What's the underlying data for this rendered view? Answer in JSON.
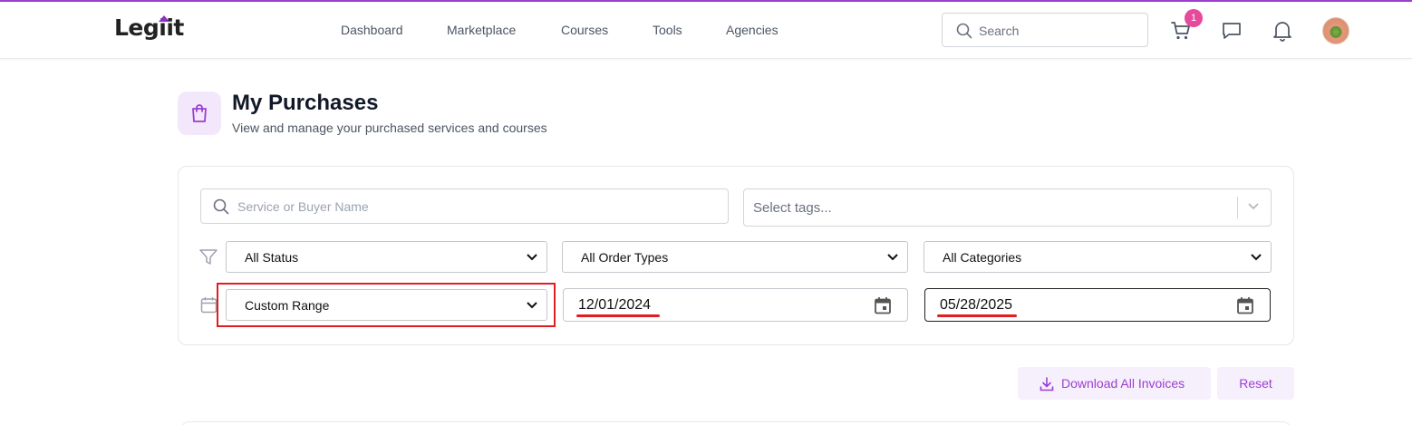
{
  "brand": {
    "name": "Legiit",
    "accent_color": "#9b3fd1"
  },
  "nav": {
    "links": [
      "Dashboard",
      "Marketplace",
      "Courses",
      "Tools",
      "Agencies"
    ]
  },
  "header": {
    "search_placeholder": "Search",
    "cart_count": "1",
    "icons": [
      "cart-icon",
      "chat-icon",
      "bell-icon",
      "avatar"
    ]
  },
  "page": {
    "title": "My Purchases",
    "subtitle": "View and manage your purchased services and courses",
    "icon": "shopping-bag-icon"
  },
  "filters": {
    "search_placeholder": "Service or Buyer Name",
    "tags_placeholder": "Select tags...",
    "status": "All Status",
    "order_type": "All Order Types",
    "category": "All Categories",
    "date_range": "Custom Range",
    "date_from": "12/01/2024",
    "date_to": "05/28/2025"
  },
  "actions": {
    "download_label": "Download All Invoices",
    "reset_label": "Reset"
  },
  "annotation_color": "#e11d22"
}
